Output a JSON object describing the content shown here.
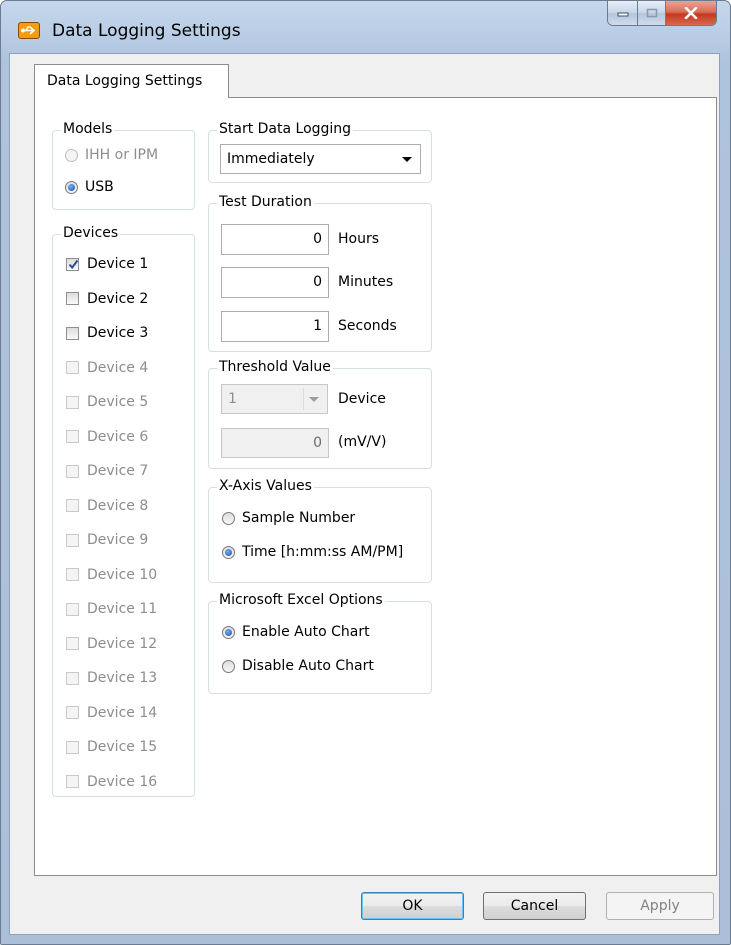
{
  "window": {
    "title": "Data Logging Settings",
    "icon": "usb-logger-icon"
  },
  "tab": {
    "label": "Data Logging Settings"
  },
  "models": {
    "label": "Models",
    "options": [
      {
        "label": "IHH or IPM",
        "selected": false,
        "enabled": false
      },
      {
        "label": "USB",
        "selected": true,
        "enabled": true
      }
    ]
  },
  "devices": {
    "label": "Devices",
    "items": [
      {
        "label": "Device 1",
        "checked": true,
        "enabled": true
      },
      {
        "label": "Device 2",
        "checked": false,
        "enabled": true
      },
      {
        "label": "Device 3",
        "checked": false,
        "enabled": true
      },
      {
        "label": "Device 4",
        "checked": false,
        "enabled": false
      },
      {
        "label": "Device 5",
        "checked": false,
        "enabled": false
      },
      {
        "label": "Device 6",
        "checked": false,
        "enabled": false
      },
      {
        "label": "Device 7",
        "checked": false,
        "enabled": false
      },
      {
        "label": "Device 8",
        "checked": false,
        "enabled": false
      },
      {
        "label": "Device 9",
        "checked": false,
        "enabled": false
      },
      {
        "label": "Device 10",
        "checked": false,
        "enabled": false
      },
      {
        "label": "Device 11",
        "checked": false,
        "enabled": false
      },
      {
        "label": "Device 12",
        "checked": false,
        "enabled": false
      },
      {
        "label": "Device 13",
        "checked": false,
        "enabled": false
      },
      {
        "label": "Device 14",
        "checked": false,
        "enabled": false
      },
      {
        "label": "Device 15",
        "checked": false,
        "enabled": false
      },
      {
        "label": "Device 16",
        "checked": false,
        "enabled": false
      }
    ]
  },
  "start_logging": {
    "label": "Start Data Logging",
    "value": "Immediately"
  },
  "test_duration": {
    "label": "Test Duration",
    "hours": "0",
    "hours_label": "Hours",
    "minutes": "0",
    "minutes_label": "Minutes",
    "seconds": "1",
    "seconds_label": "Seconds"
  },
  "threshold": {
    "label": "Threshold Value",
    "device_value": "1",
    "device_label": "Device",
    "value": "0",
    "unit": "(mV/V)"
  },
  "xaxis": {
    "label": "X-Axis Values",
    "option_sample": "Sample Number",
    "option_time": "Time [h:mm:ss AM/PM]",
    "selected": "time"
  },
  "excel": {
    "label": "Microsoft Excel Options",
    "option_enable": "Enable Auto Chart",
    "option_disable": "Disable Auto Chart",
    "selected": "enable"
  },
  "buttons": {
    "ok": "OK",
    "cancel": "Cancel",
    "apply": "Apply"
  },
  "colors": {
    "title_bar": "#b7cbe3",
    "close_button": "#c4391f",
    "radio_selected": "#1a4f9e"
  }
}
